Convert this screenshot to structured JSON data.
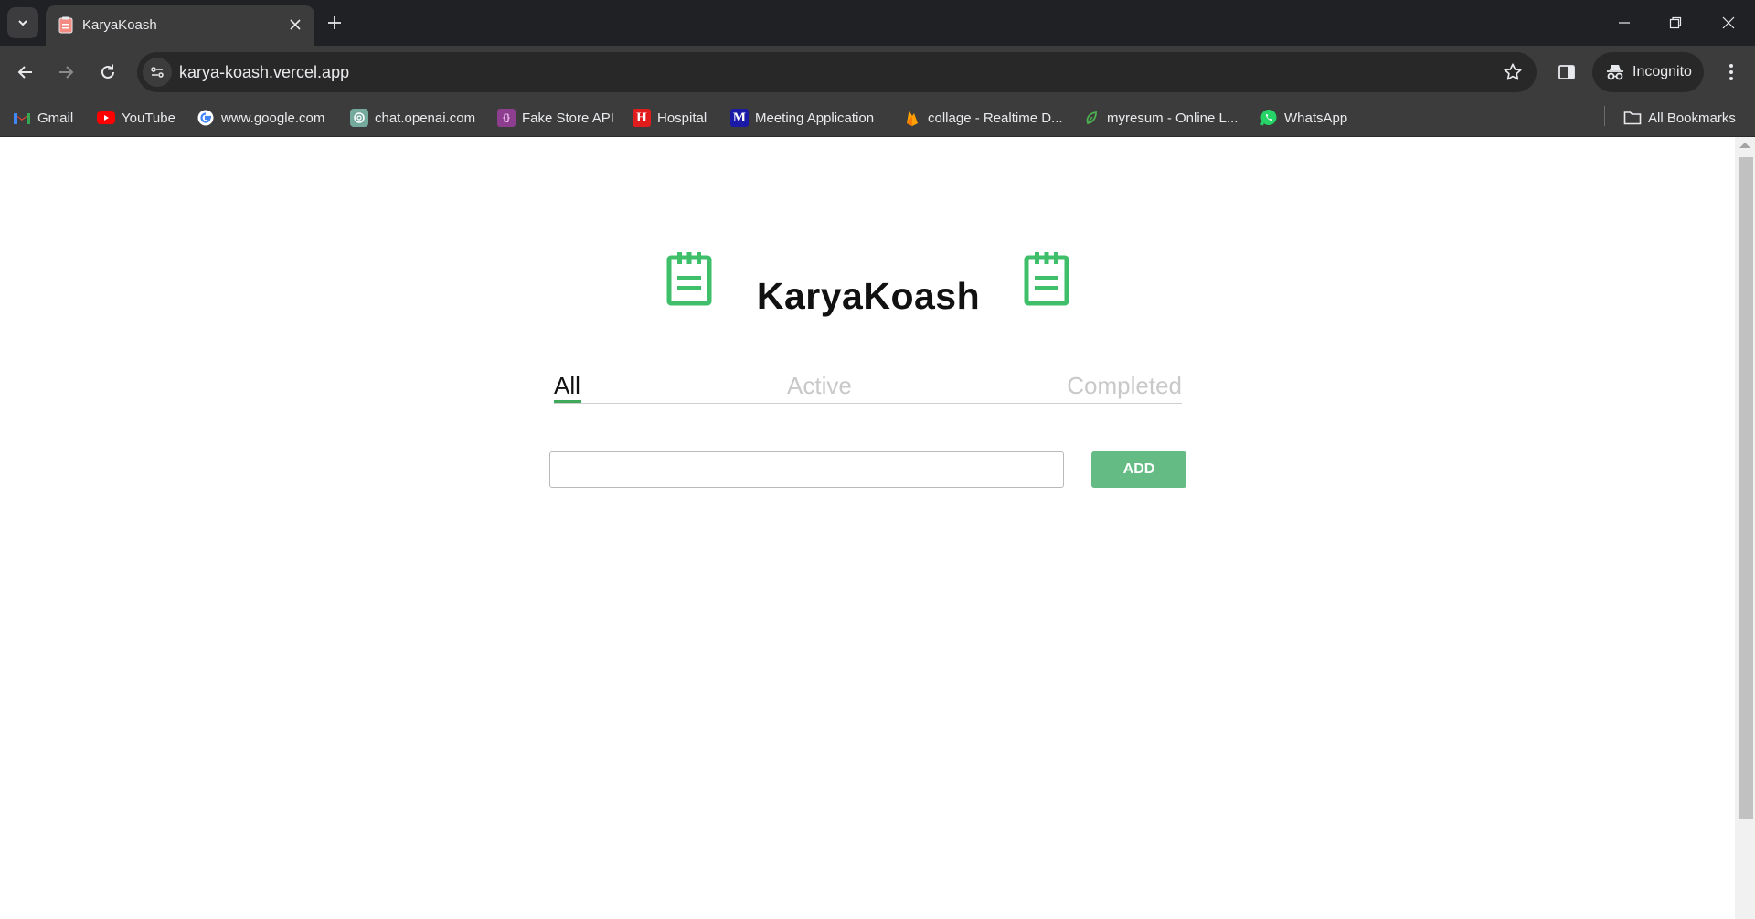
{
  "browser": {
    "tab": {
      "title": "KaryaKoash"
    },
    "address_bar": {
      "url": "karya-koash.vercel.app"
    },
    "profile": {
      "label": "Incognito"
    },
    "bookmarks": [
      {
        "label": "Gmail",
        "icon": "gmail-icon"
      },
      {
        "label": "YouTube",
        "icon": "youtube-icon"
      },
      {
        "label": "www.google.com",
        "icon": "google-icon"
      },
      {
        "label": "chat.openai.com",
        "icon": "openai-icon"
      },
      {
        "label": "Fake Store API",
        "icon": "fake-store-icon"
      },
      {
        "label": "Hospital",
        "icon": "hospital-icon"
      },
      {
        "label": "Meeting Application",
        "icon": "meeting-icon"
      },
      {
        "label": "collage - Realtime D...",
        "icon": "firebase-icon"
      },
      {
        "label": "myresum - Online L...",
        "icon": "leaf-icon"
      },
      {
        "label": "WhatsApp",
        "icon": "whatsapp-icon"
      }
    ],
    "all_bookmarks": "All Bookmarks"
  },
  "app": {
    "title": "KaryaKoash",
    "accent_color": "#3fa85a",
    "filters": [
      {
        "label": "All",
        "active": true
      },
      {
        "label": "Active",
        "active": false
      },
      {
        "label": "Completed",
        "active": false
      }
    ],
    "input": {
      "value": "",
      "placeholder": ""
    },
    "add_button": "ADD"
  }
}
